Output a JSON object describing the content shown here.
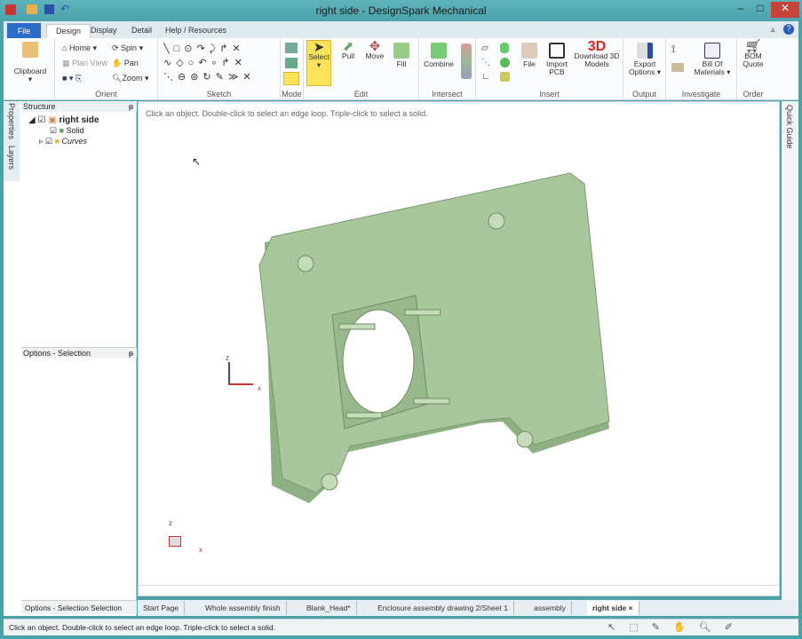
{
  "window": {
    "title": "right side - DesignSpark Mechanical",
    "minimize": "–",
    "maximize": "□",
    "close": "✕"
  },
  "ribbon_tabs": [
    "File",
    "Design",
    "Display",
    "Detail",
    "Help / Resources"
  ],
  "ribbon": {
    "clipboard": {
      "label": "Clipboard",
      "group": ""
    },
    "orient": {
      "home": "Home",
      "spin": "Spin",
      "plan_view": "Plan View",
      "pan": "Pan",
      "zoom": "Zoom",
      "group": "Orient"
    },
    "sketch": {
      "group": "Sketch"
    },
    "mode": {
      "group": "Mode"
    },
    "edit": {
      "select": "Select",
      "pull": "Pull",
      "move": "Move",
      "fill": "Fill",
      "group": "Edit"
    },
    "intersect": {
      "combine": "Combine",
      "group": "Intersect"
    },
    "insert": {
      "file": "File",
      "import_pcb": "Import PCB",
      "download_3d": "Download 3D Models",
      "group": "Insert"
    },
    "output": {
      "export": "Export Options",
      "group": "Output"
    },
    "investigate": {
      "bom": "Bill Of Materials",
      "group": "Investigate"
    },
    "order": {
      "bom_quote": "BOM Quote",
      "group": "Order"
    }
  },
  "side_tabs": [
    "Properties",
    "Layers"
  ],
  "structure": {
    "title": "Structure",
    "tree": [
      {
        "label": "right side"
      },
      {
        "label": "Solid"
      },
      {
        "label": "Curves"
      }
    ]
  },
  "options": {
    "title": "Options - Selection"
  },
  "bottom_tabs": [
    "Options - Selection",
    "Selection"
  ],
  "viewport": {
    "hint": "Click an object. Double-click to select an edge loop. Triple-click to select a solid.",
    "axis_z": "z",
    "axis_x": "x"
  },
  "quick_guide": "Quick Guide",
  "doc_tabs": [
    "Start Page",
    "Whole assembly finish",
    "Blank_Head*",
    "Enclosure assembly drawing 2/Sheet 1",
    "assembly",
    "right side ×"
  ],
  "status": "Click an object. Double-click to select an edge loop. Triple-click to select a solid.",
  "colors": {
    "accent": "#2a6cc8",
    "part": "#a6c79a",
    "frame": "#4aa3ab"
  }
}
